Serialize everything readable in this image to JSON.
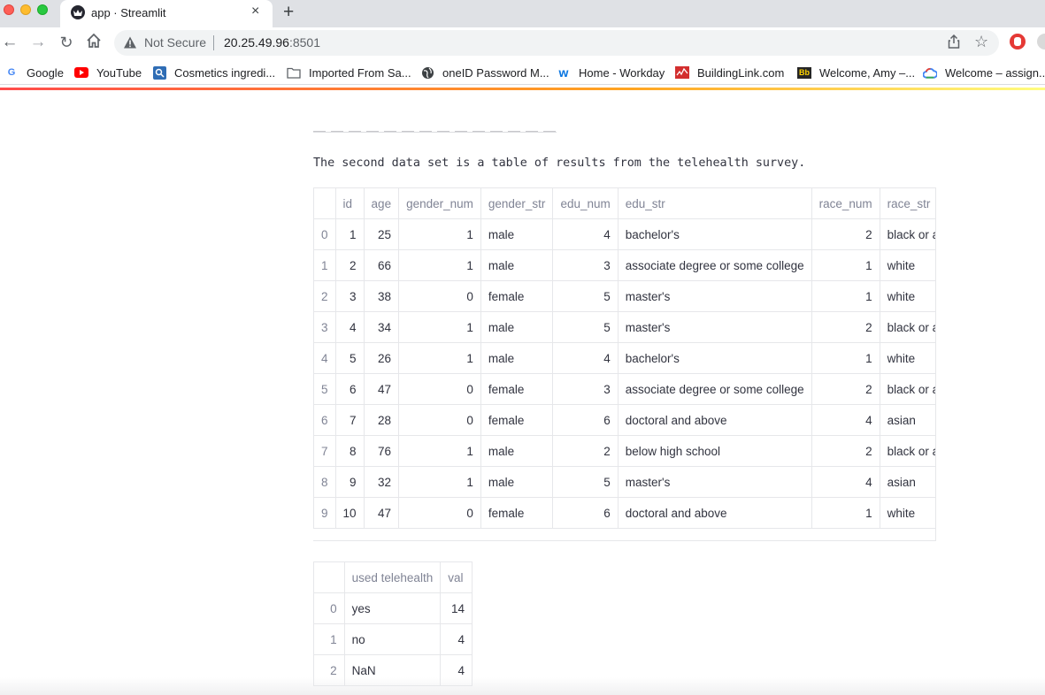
{
  "browser": {
    "tab_title": "app · Streamlit",
    "tab_close_glyph": "×",
    "new_tab_glyph": "+",
    "security_label": "Not Secure",
    "url_host": "20.25.49.96",
    "url_port": ":8501",
    "bookmarks": [
      {
        "label": "Google",
        "icon": "google-icon"
      },
      {
        "label": "YouTube",
        "icon": "youtube-icon"
      },
      {
        "label": "Cosmetics ingredi...",
        "icon": "search-app-icon"
      },
      {
        "label": "Imported From Sa...",
        "icon": "folder-icon"
      },
      {
        "label": "oneID Password M...",
        "icon": "globe-icon"
      },
      {
        "label": "Home - Workday",
        "icon": "workday-icon"
      },
      {
        "label": "BuildingLink.com",
        "icon": "buildinglink-icon"
      },
      {
        "label": "Welcome, Amy –...",
        "icon": "blackboard-icon"
      },
      {
        "label": "Welcome – assign...",
        "icon": "cloud-icon"
      }
    ]
  },
  "page": {
    "intro_text": "The second data set is a table of results from the telehealth survey."
  },
  "survey_table": {
    "columns": [
      "",
      "id",
      "age",
      "gender_num",
      "gender_str",
      "edu_num",
      "edu_str",
      "race_num",
      "race_str"
    ],
    "rows": [
      [
        "0",
        "1",
        "25",
        "1",
        "male",
        "4",
        "bachelor's",
        "2",
        "black or af"
      ],
      [
        "1",
        "2",
        "66",
        "1",
        "male",
        "3",
        "associate degree or some college",
        "1",
        "white"
      ],
      [
        "2",
        "3",
        "38",
        "0",
        "female",
        "5",
        "master's",
        "1",
        "white"
      ],
      [
        "3",
        "4",
        "34",
        "1",
        "male",
        "5",
        "master's",
        "2",
        "black or af"
      ],
      [
        "4",
        "5",
        "26",
        "1",
        "male",
        "4",
        "bachelor's",
        "1",
        "white"
      ],
      [
        "5",
        "6",
        "47",
        "0",
        "female",
        "3",
        "associate degree or some college",
        "2",
        "black or af"
      ],
      [
        "6",
        "7",
        "28",
        "0",
        "female",
        "6",
        "doctoral and above",
        "4",
        "asian"
      ],
      [
        "7",
        "8",
        "76",
        "1",
        "male",
        "2",
        "below high school",
        "2",
        "black or af"
      ],
      [
        "8",
        "9",
        "32",
        "1",
        "male",
        "5",
        "master's",
        "4",
        "asian"
      ],
      [
        "9",
        "10",
        "47",
        "0",
        "female",
        "6",
        "doctoral and above",
        "1",
        "white"
      ]
    ]
  },
  "telehealth_table": {
    "columns": [
      "",
      "used telehealth",
      "val"
    ],
    "rows": [
      [
        "0",
        "yes",
        "14"
      ],
      [
        "1",
        "no",
        "4"
      ],
      [
        "2",
        "NaN",
        "4"
      ]
    ]
  },
  "colors": {
    "streamlit_accent": "#ff4b4b",
    "header_text": "#808495",
    "body_text": "#31333f",
    "grid_line": "#e6e7ea"
  }
}
